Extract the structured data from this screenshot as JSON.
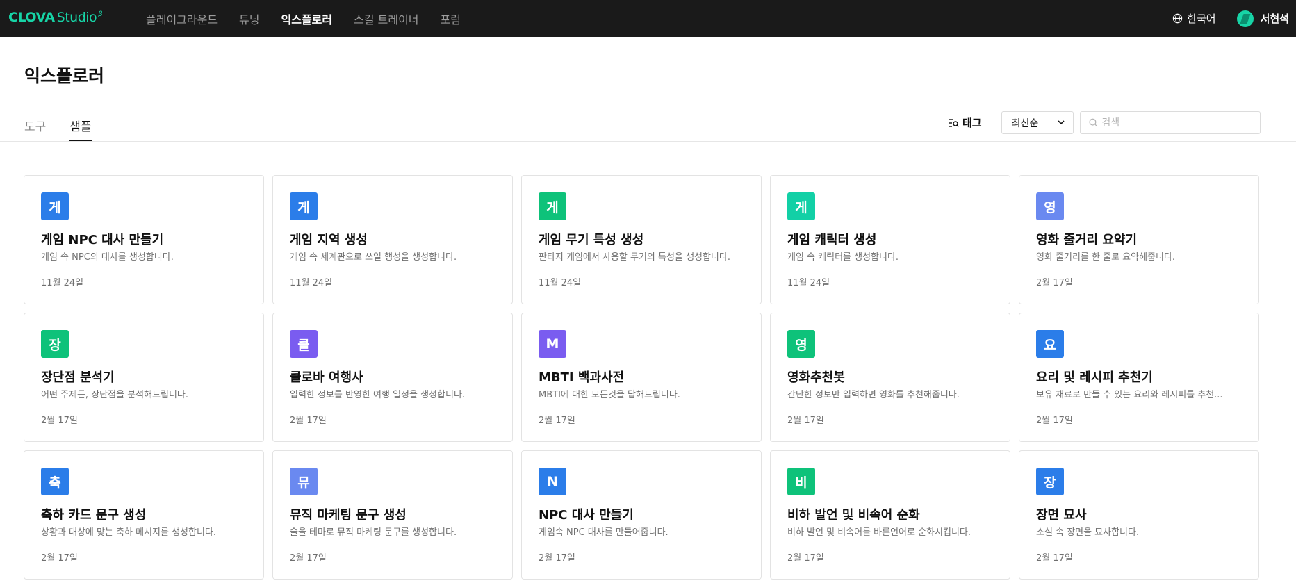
{
  "brand": {
    "name_bold": "CLOVA",
    "name_light": "Studio",
    "beta": "β"
  },
  "nav": [
    {
      "label": "플레이그라운드",
      "active": false
    },
    {
      "label": "튜닝",
      "active": false
    },
    {
      "label": "익스플로러",
      "active": true
    },
    {
      "label": "스킬 트레이너",
      "active": false
    },
    {
      "label": "포럼",
      "active": false
    }
  ],
  "language": {
    "label": "한국어",
    "icon": "globe-icon"
  },
  "user": {
    "name": "서현석"
  },
  "page": {
    "title": "익스플로러"
  },
  "tabs": [
    {
      "label": "도구",
      "active": false
    },
    {
      "label": "샘플",
      "active": true
    }
  ],
  "filters": {
    "tag_label": "태그",
    "sort_value": "최신순",
    "search_placeholder": "검색"
  },
  "cards": [
    {
      "badge": "게",
      "color": "#2b7de9",
      "title": "게임 NPC 대사 만들기",
      "desc": "게임 속 NPC의 대사를 생성합니다.",
      "date": "11월 24일"
    },
    {
      "badge": "게",
      "color": "#2b7de9",
      "title": "게임 지역 생성",
      "desc": "게임 속 세계관으로 쓰일 행성을 생성합니다.",
      "date": "11월 24일"
    },
    {
      "badge": "게",
      "color": "#0ec27a",
      "title": "게임 무기 특성 생성",
      "desc": "판타지 게임에서 사용할 무기의 특성을 생성합니다.",
      "date": "11월 24일"
    },
    {
      "badge": "게",
      "color": "#12d0a6",
      "title": "게임 캐릭터 생성",
      "desc": "게임 속 캐릭터를 생성합니다.",
      "date": "11월 24일"
    },
    {
      "badge": "영",
      "color": "#6a89f0",
      "title": "영화 줄거리 요약기",
      "desc": "영화 줄거리를 한 줄로 요약해줍니다.",
      "date": "2월 17일"
    },
    {
      "badge": "장",
      "color": "#0ec27a",
      "title": "장단점 분석기",
      "desc": "어떤 주제든, 장단점을 분석해드립니다.",
      "date": "2월 17일"
    },
    {
      "badge": "클",
      "color": "#7a5cf0",
      "title": "클로바 여행사",
      "desc": "입력한 정보를 반영한 여행 일정을 생성합니다.",
      "date": "2월 17일"
    },
    {
      "badge": "M",
      "color": "#7a5cf0",
      "title": "MBTI 백과사전",
      "desc": "MBTI에 대한 모든것을 답해드립니다.",
      "date": "2월 17일"
    },
    {
      "badge": "영",
      "color": "#0ec27a",
      "title": "영화추천봇",
      "desc": "간단한 정보만 입력하면 영화를 추천해줍니다.",
      "date": "2월 17일"
    },
    {
      "badge": "요",
      "color": "#2b7de9",
      "title": "요리 및 레시피 추천기",
      "desc": "보유 재료로 만들 수 있는 요리와 레시피를 추천...",
      "date": "2월 17일"
    },
    {
      "badge": "축",
      "color": "#2b7de9",
      "title": "축하 카드 문구 생성",
      "desc": "상황과 대상에 맞는 축하 메시지를 생성합니다.",
      "date": "2월 17일"
    },
    {
      "badge": "뮤",
      "color": "#6a89f0",
      "title": "뮤직 마케팅 문구 생성",
      "desc": "술을 테마로 뮤직 마케팅 문구를 생성합니다.",
      "date": "2월 17일"
    },
    {
      "badge": "N",
      "color": "#2b7de9",
      "title": "NPC 대사 만들기",
      "desc": "게임속 NPC 대사를 만들어줍니다.",
      "date": "2월 17일"
    },
    {
      "badge": "비",
      "color": "#0ec27a",
      "title": "비하 발언 및 비속어 순화",
      "desc": "비하 발언 및 비속어를 바른언어로 순화시킵니다.",
      "date": "2월 17일"
    },
    {
      "badge": "장",
      "color": "#2b7de9",
      "title": "장면 묘사",
      "desc": "소설 속 장면을 묘사합니다.",
      "date": "2월 17일"
    }
  ]
}
